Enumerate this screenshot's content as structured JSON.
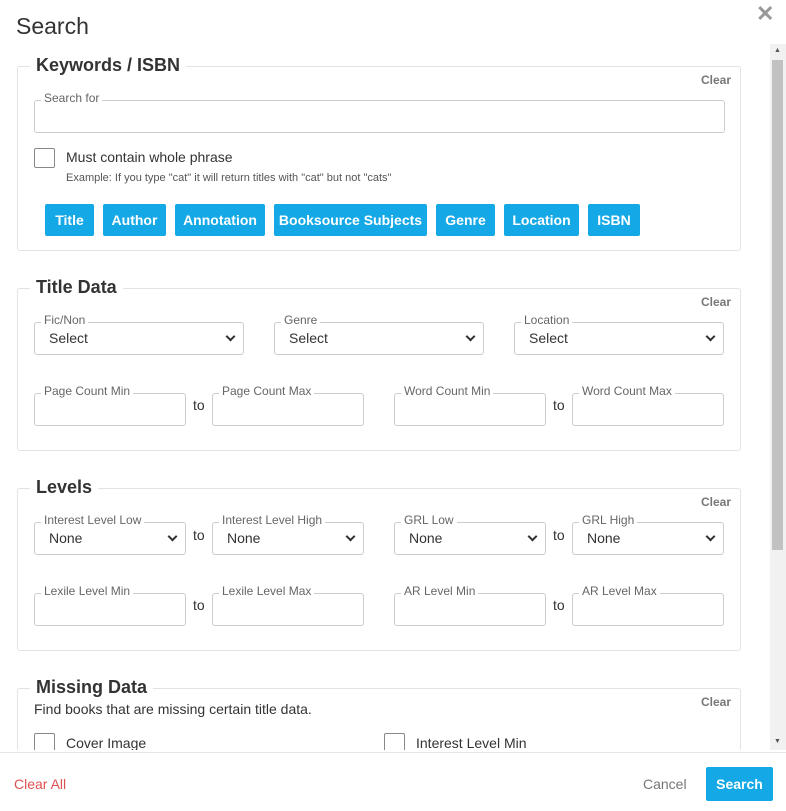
{
  "dialog": {
    "title": "Search"
  },
  "clear_label": "Clear",
  "keywords": {
    "title": "Keywords / ISBN",
    "search_label": "Search for",
    "search_value": "",
    "phrase_label": "Must contain whole phrase",
    "phrase_checked": false,
    "example": "Example: If you type \"cat\" it will return titles with \"cat\" but not \"cats\"",
    "fields": [
      "Title",
      "Author",
      "Annotation",
      "Booksource Subjects",
      "Genre",
      "Location",
      "ISBN"
    ]
  },
  "title_data": {
    "title": "Title Data",
    "fic_non": {
      "label": "Fic/Non",
      "value": "Select"
    },
    "genre": {
      "label": "Genre",
      "value": "Select"
    },
    "location": {
      "label": "Location",
      "value": "Select"
    },
    "to": "to",
    "page_min": "Page Count Min",
    "page_max": "Page Count Max",
    "word_min": "Word Count Min",
    "word_max": "Word Count Max"
  },
  "levels": {
    "title": "Levels",
    "interest_low": {
      "label": "Interest Level Low",
      "value": "None"
    },
    "interest_high": {
      "label": "Interest Level High",
      "value": "None"
    },
    "grl_low": {
      "label": "GRL Low",
      "value": "None"
    },
    "grl_high": {
      "label": "GRL High",
      "value": "None"
    },
    "lexile_min": "Lexile Level Min",
    "lexile_max": "Lexile Level Max",
    "ar_min": "AR Level Min",
    "ar_max": "AR Level Max"
  },
  "missing": {
    "title": "Missing Data",
    "description": "Find books that are missing certain title data.",
    "cover_image": "Cover Image",
    "interest_level_min": "Interest Level Min"
  },
  "footer": {
    "clear_all": "Clear All",
    "cancel": "Cancel",
    "search": "Search"
  }
}
